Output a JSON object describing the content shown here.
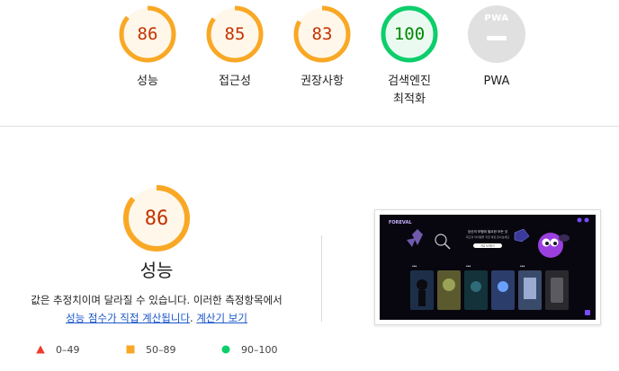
{
  "categories": [
    {
      "score": "86",
      "label": "성능",
      "fraction": 0.86,
      "status": "average"
    },
    {
      "score": "85",
      "label": "접근성",
      "fraction": 0.85,
      "status": "average"
    },
    {
      "score": "83",
      "label": "권장사항",
      "fraction": 0.83,
      "status": "average"
    },
    {
      "score": "100",
      "label_line1": "검색엔진",
      "label_line2": "최적화",
      "fraction": 1.0,
      "status": "pass"
    },
    {
      "badge": "PWA",
      "label": "PWA",
      "status": "na"
    }
  ],
  "performance": {
    "score": "86",
    "fraction": 0.86,
    "title": "성능",
    "desc_line1": "값은 추정치이며 달라질 수 있습니다. 이러한 측정항목에서",
    "link_calc": "성능 점수가 직접 계산됩니다",
    "desc_period": ". ",
    "link_calculator": "계산기 보기"
  },
  "legend": [
    {
      "range": "0–49",
      "shape": "triangle",
      "color": "#eb3b2e"
    },
    {
      "range": "50–89",
      "shape": "square",
      "color": "#f9a825"
    },
    {
      "range": "90–100",
      "shape": "circle",
      "color": "#0cce6b"
    }
  ],
  "colors": {
    "average_ring": "#f9a825",
    "average_text": "#c33300",
    "average_fill": "#fff7ea",
    "pass_ring": "#0cce6b",
    "pass_text": "#008800",
    "pass_fill": "#eafaf1",
    "na_fill": "#e0e0e0",
    "na_text": "#ffffff",
    "link": "#1a56c8"
  },
  "thumbnail": {
    "brand": "FOREVAL",
    "headline_line1": "당신의 모험에 필요한 모든 것",
    "headline_line2": "최고의 아이템을 지금 바로 만나보세요",
    "cta": "지금 시작하기"
  }
}
